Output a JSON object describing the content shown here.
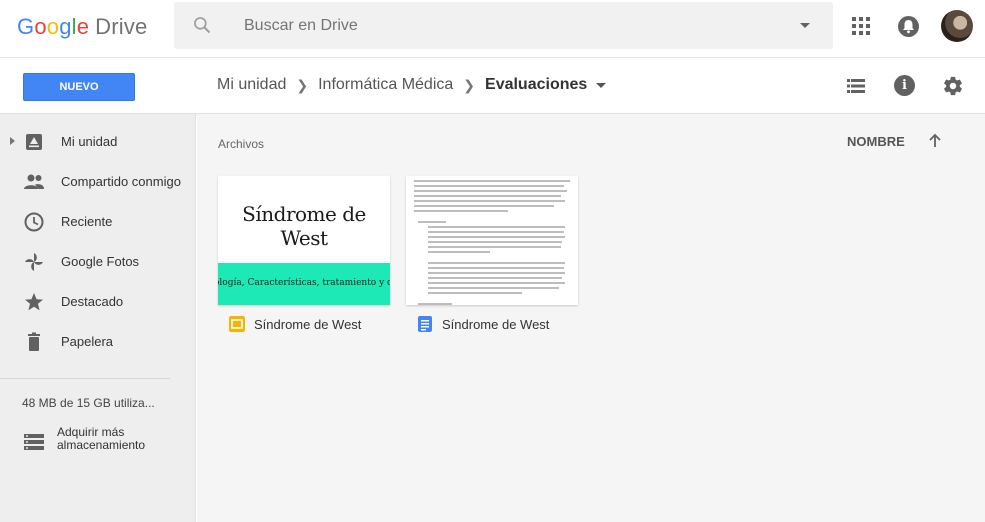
{
  "header": {
    "logo_google": [
      "G",
      "o",
      "o",
      "g",
      "l",
      "e"
    ],
    "logo_product": "Drive",
    "search_placeholder": "Buscar en Drive"
  },
  "toolbar": {
    "new_button": "NUEVO",
    "breadcrumb": [
      "Mi unidad",
      "Informática Médica",
      "Evaluaciones"
    ]
  },
  "sidebar": {
    "items": [
      {
        "label": "Mi unidad",
        "icon": "drive-icon"
      },
      {
        "label": "Compartido conmigo",
        "icon": "people-icon"
      },
      {
        "label": "Reciente",
        "icon": "clock-icon"
      },
      {
        "label": "Google Fotos",
        "icon": "photos-icon"
      },
      {
        "label": "Destacado",
        "icon": "star-icon"
      },
      {
        "label": "Papelera",
        "icon": "trash-icon"
      }
    ],
    "storage": "48 MB de 15 GB utiliza...",
    "buy_storage": "Adquirir más almacenamiento"
  },
  "main": {
    "section": "Archivos",
    "sort_label": "NOMBRE",
    "files": [
      {
        "name": "Síndrome de West",
        "type": "slides",
        "thumb_title": "Síndrome de West",
        "thumb_subtitle": "ología, Características, tratamiento y cui"
      },
      {
        "name": "Síndrome de West",
        "type": "document"
      }
    ]
  },
  "colors": {
    "accent": "#4285f4",
    "slides_icon": "#f4b400",
    "docs_icon": "#4285f4",
    "slide_band": "#1de9b6"
  }
}
